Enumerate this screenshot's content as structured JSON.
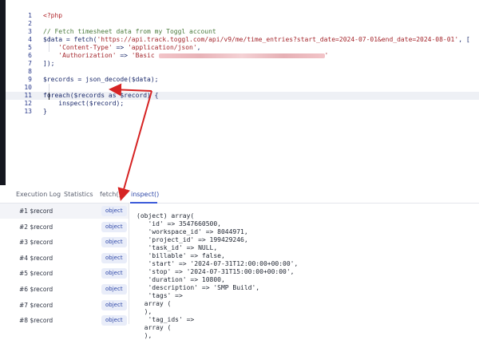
{
  "editor": {
    "lines": [
      {
        "n": "1",
        "text": "<?php",
        "cls": "red"
      },
      {
        "n": "2",
        "text": "",
        "cls": ""
      },
      {
        "n": "3",
        "text": "// Fetch timesheet data from my Toggl account",
        "cls": "cm"
      },
      {
        "n": "4",
        "pre": "$data = fetch(",
        "str": "'https://api.track.toggl.com/api/v9/me/time_entries?start_date=2024-07-01&end_date=2024-08-01'",
        "post": ", ["
      },
      {
        "n": "5",
        "pre": "    ",
        "str": "'Content-Type'",
        "mid": " => ",
        "str2": "'application/json'",
        "post": ","
      },
      {
        "n": "6",
        "pre": "    ",
        "str": "'Authorization'",
        "mid": " => ",
        "str2": "'Basic ",
        "blur": true,
        "post": "'"
      },
      {
        "n": "7",
        "text": "]);",
        "cls": "kw"
      },
      {
        "n": "8",
        "text": "",
        "cls": ""
      },
      {
        "n": "9",
        "text": "$records = json_decode($data);",
        "cls": "kw"
      },
      {
        "n": "10",
        "text": "",
        "cls": ""
      },
      {
        "n": "11",
        "text": "foreach($records as $record) {",
        "cls": "kw"
      },
      {
        "n": "12",
        "text": "    inspect($record);",
        "cls": "kw"
      },
      {
        "n": "13",
        "text": "}",
        "cls": "kw"
      }
    ]
  },
  "tabs": [
    "Execution Log",
    "Statistics",
    "fetch()",
    "inspect()"
  ],
  "records": [
    {
      "label": "#1 $record",
      "type": "object"
    },
    {
      "label": "#2 $record",
      "type": "object"
    },
    {
      "label": "#3 $record",
      "type": "object"
    },
    {
      "label": "#4 $record",
      "type": "object"
    },
    {
      "label": "#5 $record",
      "type": "object"
    },
    {
      "label": "#6 $record",
      "type": "object"
    },
    {
      "label": "#7 $record",
      "type": "object"
    },
    {
      "label": "#8 $record",
      "type": "object"
    }
  ],
  "output_lines": [
    "(object) array(",
    "   'id' => 3547660500,",
    "   'workspace_id' => 8044971,",
    "   'project_id' => 199429246,",
    "   'task_id' => NULL,",
    "   'billable' => false,",
    "   'start' => '2024-07-31T12:00:00+00:00',",
    "   'stop' => '2024-07-31T15:00:00+00:00',",
    "   'duration' => 10800,",
    "   'description' => 'SMP Build',",
    "   'tags' =>",
    "  array (",
    "  ),",
    "   'tag_ids' =>",
    "  array (",
    "  ),"
  ],
  "colors": {
    "arrow": "#d62323",
    "accent": "#3b5bd9"
  }
}
